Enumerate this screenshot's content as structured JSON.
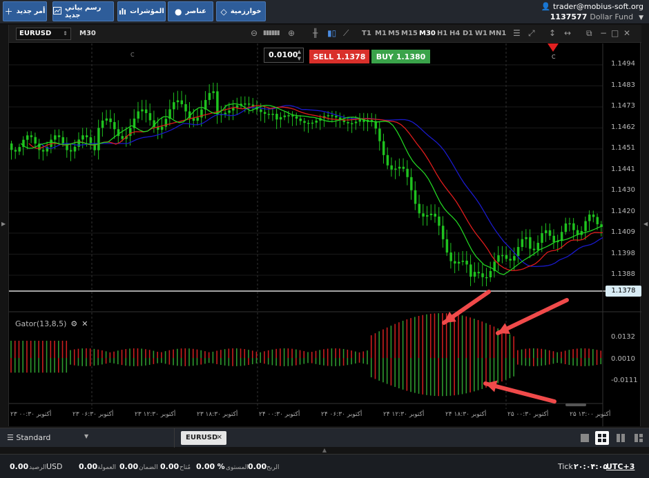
{
  "toolbar": {
    "buttons": [
      {
        "label": "أمر جديد",
        "icon": "plus-icon"
      },
      {
        "label": "رسم بياني جديد",
        "icon": "chart-icon"
      },
      {
        "label": "المؤشرات",
        "icon": "bar-chart-icon"
      },
      {
        "label": "عناصر",
        "icon": "shapes-icon"
      },
      {
        "label": "خوارزمية",
        "icon": "diamond-icon"
      }
    ]
  },
  "account": {
    "user": "trader@mobius-soft.org",
    "number": "1137577",
    "fund": "Dollar Fund"
  },
  "chart": {
    "symbol": "EURUSD",
    "timeframe": "M30",
    "timeframes": [
      "T1",
      "M1",
      "M5",
      "M15",
      "M30",
      "H1",
      "H4",
      "D1",
      "W1",
      "MN1"
    ],
    "active_timeframe": "M30",
    "lot": "0.0100",
    "sell_label": "SELL 1.1378",
    "buy_label": "BUY 1.1380",
    "current_price": "1.1378",
    "price_axis": [
      "1.1494",
      "1.1483",
      "1.1473",
      "1.1462",
      "1.1451",
      "1.1441",
      "1.1430",
      "1.1420",
      "1.1409",
      "1.1398",
      "1.1388"
    ],
    "indicator_label": "Gator(13,8,5)",
    "indicator_axis": [
      "0.0132",
      "0.0010",
      "-0.0111"
    ],
    "time_axis": [
      "۲۳ أكتوبر ۰۰:۳۰",
      "۲۳ أكتوبر ۰۶:۳۰",
      "۲۳ أكتوبر ۱۲:۳۰",
      "۲۳ أكتوبر ۱۸:۳۰",
      "۲۴ أكتوبر ۰۰:۳۰",
      "۲۴ أكتوبر ۰۶:۳۰",
      "۲۴ أكتوبر ۱۲:۳۰",
      "۲۴ أكتوبر ۱۸:۳۰",
      "۲۵ أكتوبر ۰۰:۳۰",
      "۲۵ أكتوبر ۱۳:۰۰"
    ],
    "marker_label": "C",
    "colors": {
      "bull": "#1fc21f",
      "bear": "#1fc21f",
      "jaw": "#1a1acc",
      "teeth": "#e01c1c",
      "lips": "#22d322",
      "hist_up": "#2e9a2e",
      "hist_down": "#cc1f1f",
      "annotation": "#f04a4a"
    }
  },
  "tabs": {
    "workspace": "Standard",
    "open_tab": "EURUSD"
  },
  "status": {
    "balance_value": "0.00",
    "balance_currency": "USD",
    "balance_label": "الرصيد",
    "commission_value": "0.00",
    "commission_label": "العمولة",
    "margin_value": "0.00",
    "margin_label": "الضمان",
    "equity_value": "0.00",
    "equity_label": "مُتاح",
    "level_value": "0.00",
    "level_suffix": "%",
    "level_label": "المستوى",
    "profit_value": "0.00",
    "profit_label": "الربح",
    "tick_label": "Tick",
    "clock": "۲۰:۰۴:۰۵",
    "timezone": "UTC+3"
  }
}
